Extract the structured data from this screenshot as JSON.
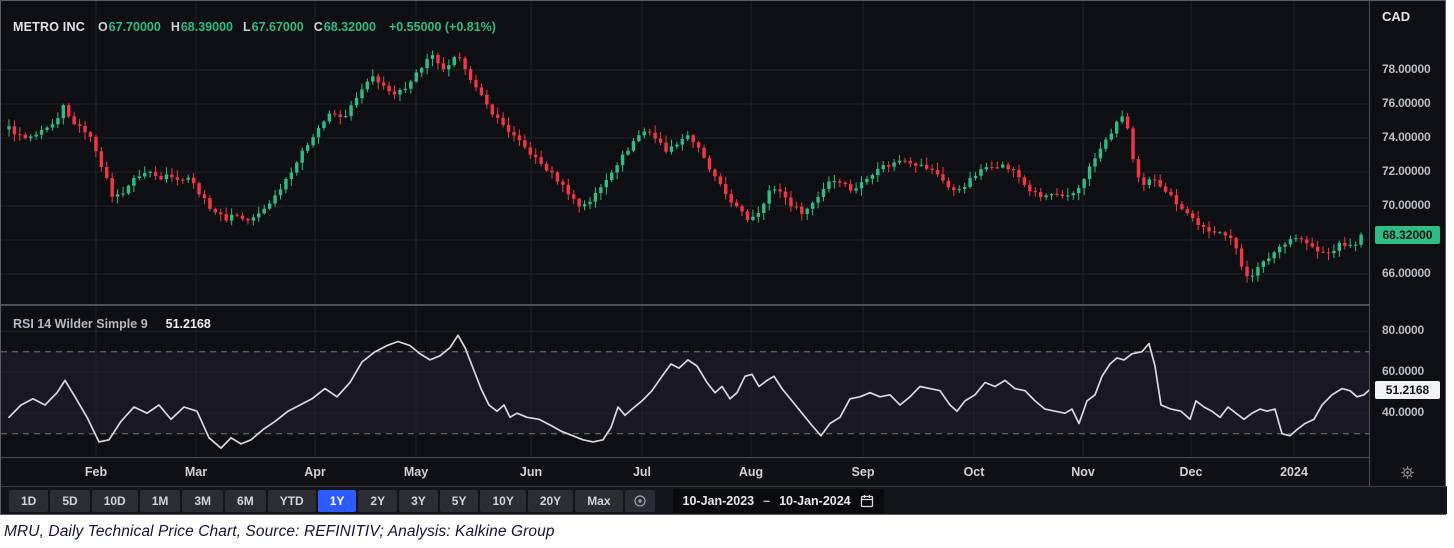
{
  "header": {
    "symbol": "METRO INC",
    "ohlc": [
      {
        "label": "O",
        "value": "67.70000"
      },
      {
        "label": "H",
        "value": "68.39000"
      },
      {
        "label": "L",
        "value": "67.67000"
      },
      {
        "label": "C",
        "value": "68.32000"
      }
    ],
    "change": "+0.55000 (+0.81%)"
  },
  "price_axis": {
    "currency": "CAD",
    "last_price": "68.32000"
  },
  "rsi": {
    "title": "RSI 14 Wilder Simple 9",
    "value": "51.2168"
  },
  "time_axis": {
    "months": [
      {
        "label": "Feb",
        "x": 95
      },
      {
        "label": "Mar",
        "x": 195
      },
      {
        "label": "Apr",
        "x": 314
      },
      {
        "label": "May",
        "x": 415
      },
      {
        "label": "Jun",
        "x": 530
      },
      {
        "label": "Jul",
        "x": 641
      },
      {
        "label": "Aug",
        "x": 750
      },
      {
        "label": "Sep",
        "x": 862
      },
      {
        "label": "Oct",
        "x": 973
      },
      {
        "label": "Nov",
        "x": 1082
      },
      {
        "label": "Dec",
        "x": 1190
      },
      {
        "label": "2024",
        "x": 1293
      }
    ]
  },
  "toolbar": {
    "ranges": [
      "1D",
      "5D",
      "10D",
      "1M",
      "3M",
      "6M",
      "YTD",
      "1Y",
      "2Y",
      "3Y",
      "5Y",
      "10Y",
      "20Y",
      "Max"
    ],
    "selected": "1Y",
    "date_from": "10-Jan-2023",
    "range_separator": "–",
    "date_to": "10-Jan-2024"
  },
  "icons": {
    "currency_selector": "chevron-down-icon",
    "jump_to": "target-icon",
    "date_picker": "calendar-icon",
    "axis_settings": "gear-icon"
  },
  "colors": {
    "up": "#2ebd85",
    "down": "#f23645",
    "accent": "#2e5bff",
    "rsi_line": "#d6d9e0",
    "grid": "#1e222a",
    "band": "#7e57c2"
  },
  "caption": "MRU,  Daily Technical Price Chart, Source: REFINITIV; Analysis: Kalkine Group",
  "chart_data": {
    "type": "candlestick",
    "title": "METRO INC",
    "currency": "CAD",
    "period": "1Y daily, 10-Jan-2023 to 10-Jan-2024",
    "ohlc_last": {
      "open": 67.7,
      "high": 68.39,
      "low": 67.67,
      "close": 68.32,
      "change": 0.55,
      "change_pct": 0.81
    },
    "ylim": [
      64.4,
      79.6
    ],
    "yticks": [
      78,
      76,
      74,
      72,
      70,
      68,
      66
    ],
    "price_keyframes": [
      [
        8,
        74.6
      ],
      [
        16,
        74.2
      ],
      [
        26,
        73.9
      ],
      [
        36,
        74.2
      ],
      [
        46,
        74.5
      ],
      [
        56,
        74.9
      ],
      [
        62,
        75.9
      ],
      [
        68,
        75.2
      ],
      [
        78,
        74.6
      ],
      [
        86,
        74.4
      ],
      [
        95,
        73.3
      ],
      [
        104,
        71.8
      ],
      [
        112,
        70.5
      ],
      [
        120,
        70.7
      ],
      [
        130,
        71.4
      ],
      [
        140,
        71.9
      ],
      [
        150,
        72.0
      ],
      [
        158,
        71.6
      ],
      [
        166,
        72.0
      ],
      [
        176,
        71.5
      ],
      [
        186,
        71.8
      ],
      [
        196,
        71.0
      ],
      [
        206,
        70.1
      ],
      [
        216,
        69.6
      ],
      [
        224,
        69.2
      ],
      [
        234,
        69.6
      ],
      [
        244,
        69.1
      ],
      [
        254,
        69.3
      ],
      [
        264,
        69.9
      ],
      [
        274,
        70.6
      ],
      [
        286,
        71.7
      ],
      [
        298,
        72.8
      ],
      [
        310,
        74.0
      ],
      [
        320,
        74.8
      ],
      [
        331,
        75.5
      ],
      [
        341,
        75.1
      ],
      [
        351,
        75.9
      ],
      [
        362,
        76.9
      ],
      [
        372,
        77.6
      ],
      [
        381,
        77.2
      ],
      [
        391,
        76.4
      ],
      [
        401,
        76.8
      ],
      [
        411,
        77.5
      ],
      [
        421,
        78.2
      ],
      [
        430,
        78.9
      ],
      [
        438,
        78.2
      ],
      [
        446,
        78.0
      ],
      [
        455,
        78.8
      ],
      [
        464,
        78.2
      ],
      [
        474,
        77.0
      ],
      [
        486,
        75.9
      ],
      [
        497,
        75.1
      ],
      [
        508,
        74.4
      ],
      [
        519,
        73.7
      ],
      [
        531,
        73.0
      ],
      [
        543,
        72.3
      ],
      [
        554,
        71.7
      ],
      [
        566,
        70.9
      ],
      [
        578,
        70.0
      ],
      [
        589,
        70.3
      ],
      [
        600,
        71.1
      ],
      [
        612,
        72.2
      ],
      [
        624,
        73.1
      ],
      [
        636,
        74.1
      ],
      [
        647,
        74.5
      ],
      [
        657,
        73.8
      ],
      [
        667,
        73.2
      ],
      [
        677,
        73.8
      ],
      [
        687,
        74.2
      ],
      [
        697,
        73.4
      ],
      [
        709,
        72.1
      ],
      [
        721,
        71.0
      ],
      [
        734,
        70.0
      ],
      [
        747,
        69.2
      ],
      [
        758,
        69.7
      ],
      [
        768,
        70.9
      ],
      [
        779,
        70.9
      ],
      [
        791,
        70.0
      ],
      [
        803,
        69.6
      ],
      [
        816,
        70.5
      ],
      [
        828,
        71.5
      ],
      [
        839,
        71.5
      ],
      [
        851,
        70.9
      ],
      [
        864,
        71.5
      ],
      [
        877,
        72.3
      ],
      [
        889,
        72.4
      ],
      [
        902,
        72.8
      ],
      [
        914,
        72.5
      ],
      [
        927,
        72.2
      ],
      [
        939,
        71.8
      ],
      [
        951,
        70.8
      ],
      [
        963,
        71.2
      ],
      [
        976,
        71.9
      ],
      [
        988,
        72.4
      ],
      [
        1001,
        72.4
      ],
      [
        1014,
        72.0
      ],
      [
        1027,
        71.0
      ],
      [
        1039,
        70.5
      ],
      [
        1052,
        70.7
      ],
      [
        1064,
        70.4
      ],
      [
        1076,
        70.9
      ],
      [
        1088,
        72.2
      ],
      [
        1100,
        73.4
      ],
      [
        1112,
        74.5
      ],
      [
        1122,
        75.4
      ],
      [
        1128,
        74.3
      ],
      [
        1134,
        71.9
      ],
      [
        1142,
        71.1
      ],
      [
        1152,
        71.7
      ],
      [
        1162,
        71.1
      ],
      [
        1174,
        70.3
      ],
      [
        1186,
        69.6
      ],
      [
        1198,
        68.9
      ],
      [
        1210,
        68.3
      ],
      [
        1220,
        68.6
      ],
      [
        1232,
        68.0
      ],
      [
        1240,
        66.5
      ],
      [
        1248,
        65.8
      ],
      [
        1258,
        66.4
      ],
      [
        1270,
        67.1
      ],
      [
        1282,
        67.8
      ],
      [
        1293,
        68.2
      ],
      [
        1304,
        67.9
      ],
      [
        1316,
        67.3
      ],
      [
        1328,
        67.2
      ],
      [
        1340,
        67.8
      ],
      [
        1351,
        67.6
      ],
      [
        1362,
        68.32
      ]
    ],
    "rsi": {
      "type": "line",
      "period": 14,
      "smoothing": "Wilder Simple 9",
      "last": 51.2168,
      "levels": [
        70,
        30
      ],
      "yticks": [
        80,
        60,
        40
      ],
      "points": [
        [
          8,
          38
        ],
        [
          20,
          44
        ],
        [
          32,
          47
        ],
        [
          44,
          44
        ],
        [
          56,
          50
        ],
        [
          64,
          56
        ],
        [
          74,
          48
        ],
        [
          86,
          38
        ],
        [
          98,
          26
        ],
        [
          108,
          27
        ],
        [
          120,
          36
        ],
        [
          133,
          43
        ],
        [
          146,
          40
        ],
        [
          158,
          44
        ],
        [
          170,
          37
        ],
        [
          183,
          43
        ],
        [
          196,
          41
        ],
        [
          208,
          28
        ],
        [
          220,
          23
        ],
        [
          230,
          28
        ],
        [
          240,
          25
        ],
        [
          250,
          27
        ],
        [
          262,
          32
        ],
        [
          274,
          36
        ],
        [
          287,
          41
        ],
        [
          299,
          44
        ],
        [
          311,
          47
        ],
        [
          324,
          52
        ],
        [
          336,
          48
        ],
        [
          349,
          55
        ],
        [
          361,
          65
        ],
        [
          374,
          70
        ],
        [
          386,
          73
        ],
        [
          397,
          75
        ],
        [
          409,
          73
        ],
        [
          419,
          69
        ],
        [
          429,
          66
        ],
        [
          439,
          68
        ],
        [
          449,
          72
        ],
        [
          457,
          78
        ],
        [
          464,
          72
        ],
        [
          472,
          62
        ],
        [
          480,
          52
        ],
        [
          488,
          44
        ],
        [
          496,
          41
        ],
        [
          503,
          44
        ],
        [
          509,
          38
        ],
        [
          516,
          40
        ],
        [
          526,
          38
        ],
        [
          538,
          37
        ],
        [
          550,
          34
        ],
        [
          561,
          31
        ],
        [
          572,
          29
        ],
        [
          582,
          27
        ],
        [
          592,
          26
        ],
        [
          602,
          27
        ],
        [
          610,
          33
        ],
        [
          617,
          43
        ],
        [
          624,
          39
        ],
        [
          631,
          42
        ],
        [
          641,
          46
        ],
        [
          651,
          51
        ],
        [
          661,
          58
        ],
        [
          670,
          64
        ],
        [
          678,
          62
        ],
        [
          687,
          66
        ],
        [
          696,
          63
        ],
        [
          706,
          55
        ],
        [
          714,
          50
        ],
        [
          721,
          53
        ],
        [
          729,
          47
        ],
        [
          736,
          50
        ],
        [
          744,
          58
        ],
        [
          751,
          59
        ],
        [
          758,
          53
        ],
        [
          766,
          56
        ],
        [
          773,
          58
        ],
        [
          781,
          52
        ],
        [
          791,
          46
        ],
        [
          801,
          40
        ],
        [
          811,
          34
        ],
        [
          820,
          29
        ],
        [
          829,
          35
        ],
        [
          839,
          38
        ],
        [
          849,
          47
        ],
        [
          859,
          48
        ],
        [
          869,
          50
        ],
        [
          879,
          48
        ],
        [
          889,
          49
        ],
        [
          899,
          44
        ],
        [
          909,
          48
        ],
        [
          919,
          53
        ],
        [
          929,
          52
        ],
        [
          939,
          51
        ],
        [
          949,
          44
        ],
        [
          956,
          41
        ],
        [
          964,
          46
        ],
        [
          974,
          49
        ],
        [
          984,
          55
        ],
        [
          994,
          53
        ],
        [
          1004,
          56
        ],
        [
          1014,
          52
        ],
        [
          1024,
          51
        ],
        [
          1034,
          46
        ],
        [
          1044,
          42
        ],
        [
          1054,
          41
        ],
        [
          1064,
          40
        ],
        [
          1071,
          42
        ],
        [
          1078,
          35
        ],
        [
          1086,
          46
        ],
        [
          1094,
          49
        ],
        [
          1101,
          58
        ],
        [
          1109,
          64
        ],
        [
          1116,
          67
        ],
        [
          1123,
          66
        ],
        [
          1131,
          69
        ],
        [
          1141,
          70
        ],
        [
          1148,
          74
        ],
        [
          1154,
          63
        ],
        [
          1160,
          44
        ],
        [
          1170,
          42
        ],
        [
          1180,
          41
        ],
        [
          1189,
          37
        ],
        [
          1195,
          46
        ],
        [
          1203,
          43
        ],
        [
          1211,
          41
        ],
        [
          1219,
          38
        ],
        [
          1227,
          43
        ],
        [
          1235,
          40
        ],
        [
          1243,
          37
        ],
        [
          1251,
          40
        ],
        [
          1259,
          42
        ],
        [
          1266,
          41
        ],
        [
          1274,
          42
        ],
        [
          1281,
          30
        ],
        [
          1289,
          29
        ],
        [
          1296,
          32
        ],
        [
          1304,
          35
        ],
        [
          1313,
          37
        ],
        [
          1321,
          44
        ],
        [
          1331,
          49
        ],
        [
          1341,
          52
        ],
        [
          1349,
          51
        ],
        [
          1356,
          48
        ],
        [
          1363,
          49
        ],
        [
          1368,
          51.2
        ]
      ]
    }
  }
}
